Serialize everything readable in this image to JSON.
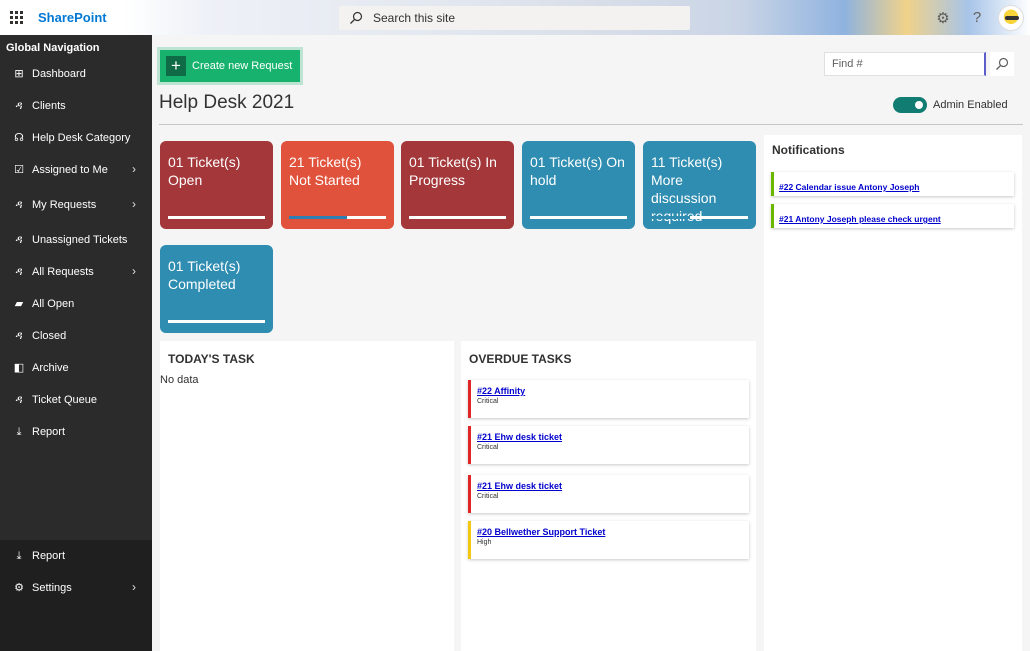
{
  "suite": {
    "brand": "SharePoint",
    "search_placeholder": "Search this site"
  },
  "leftnav": {
    "title": "Global Navigation",
    "items": [
      {
        "label": "Dashboard",
        "icon": "dashboard-icon",
        "chevron": false
      },
      {
        "label": "Clients",
        "icon": "person-add-icon",
        "chevron": false
      },
      {
        "label": "Help Desk Category",
        "icon": "headset-icon",
        "chevron": false
      },
      {
        "label": "Assigned to Me",
        "icon": "checkbox-icon",
        "chevron": true
      },
      {
        "label": "My Requests",
        "icon": "person-add-icon",
        "chevron": true
      },
      {
        "label": "Unassigned Tickets",
        "icon": "person-clock-icon",
        "chevron": false
      },
      {
        "label": "All Requests",
        "icon": "person-add-icon",
        "chevron": true
      },
      {
        "label": "All Open",
        "icon": "comment-icon",
        "chevron": false
      },
      {
        "label": "Closed",
        "icon": "person-add-icon",
        "chevron": false
      },
      {
        "label": "Archive",
        "icon": "archive-icon",
        "chevron": false
      },
      {
        "label": "Ticket Queue",
        "icon": "person-clock-icon",
        "chevron": false
      },
      {
        "label": "Report",
        "icon": "download-icon",
        "chevron": false
      }
    ],
    "bottom_items": [
      {
        "label": "Report",
        "icon": "download-icon",
        "chevron": false
      },
      {
        "label": "Settings",
        "icon": "gear-icon",
        "chevron": true
      }
    ]
  },
  "main": {
    "create_label": "Create new Request",
    "find_placeholder": "Find #",
    "page_title": "Help Desk 2021",
    "admin_label": "Admin Enabled",
    "tiles": [
      {
        "label": "01 Ticket(s) Open",
        "color": "#a4373a"
      },
      {
        "label": "21 Ticket(s) Not Started",
        "color": "#e0523b",
        "progress": 0.6
      },
      {
        "label": "01 Ticket(s) In Progress",
        "color": "#a4373a"
      },
      {
        "label": "01 Ticket(s) On hold",
        "color": "#2e8db0"
      },
      {
        "label": "11 Ticket(s) More discussion required",
        "color": "#2e8db0",
        "progress": 0.4
      },
      {
        "label": "01 Ticket(s) Completed",
        "color": "#2e8db0"
      }
    ],
    "todays_task": {
      "title": "TODAY'S TASK",
      "empty": "No data"
    },
    "overdue": {
      "title": "OVERDUE TASKS",
      "items": [
        {
          "link": "#22 Affinity",
          "priority": "Critical"
        },
        {
          "link": "#21 Ehw desk ticket",
          "priority": "Critical"
        },
        {
          "link": "#21 Ehw desk ticket",
          "priority": "Critical"
        },
        {
          "link": "#20 Bellwether Support Ticket",
          "priority": "High"
        }
      ]
    },
    "notifications": {
      "title": "Notifications",
      "items": [
        {
          "link": "#22 Calendar issue Antony Joseph"
        },
        {
          "link": "#21 Antony Joseph please check urgent"
        }
      ]
    }
  }
}
